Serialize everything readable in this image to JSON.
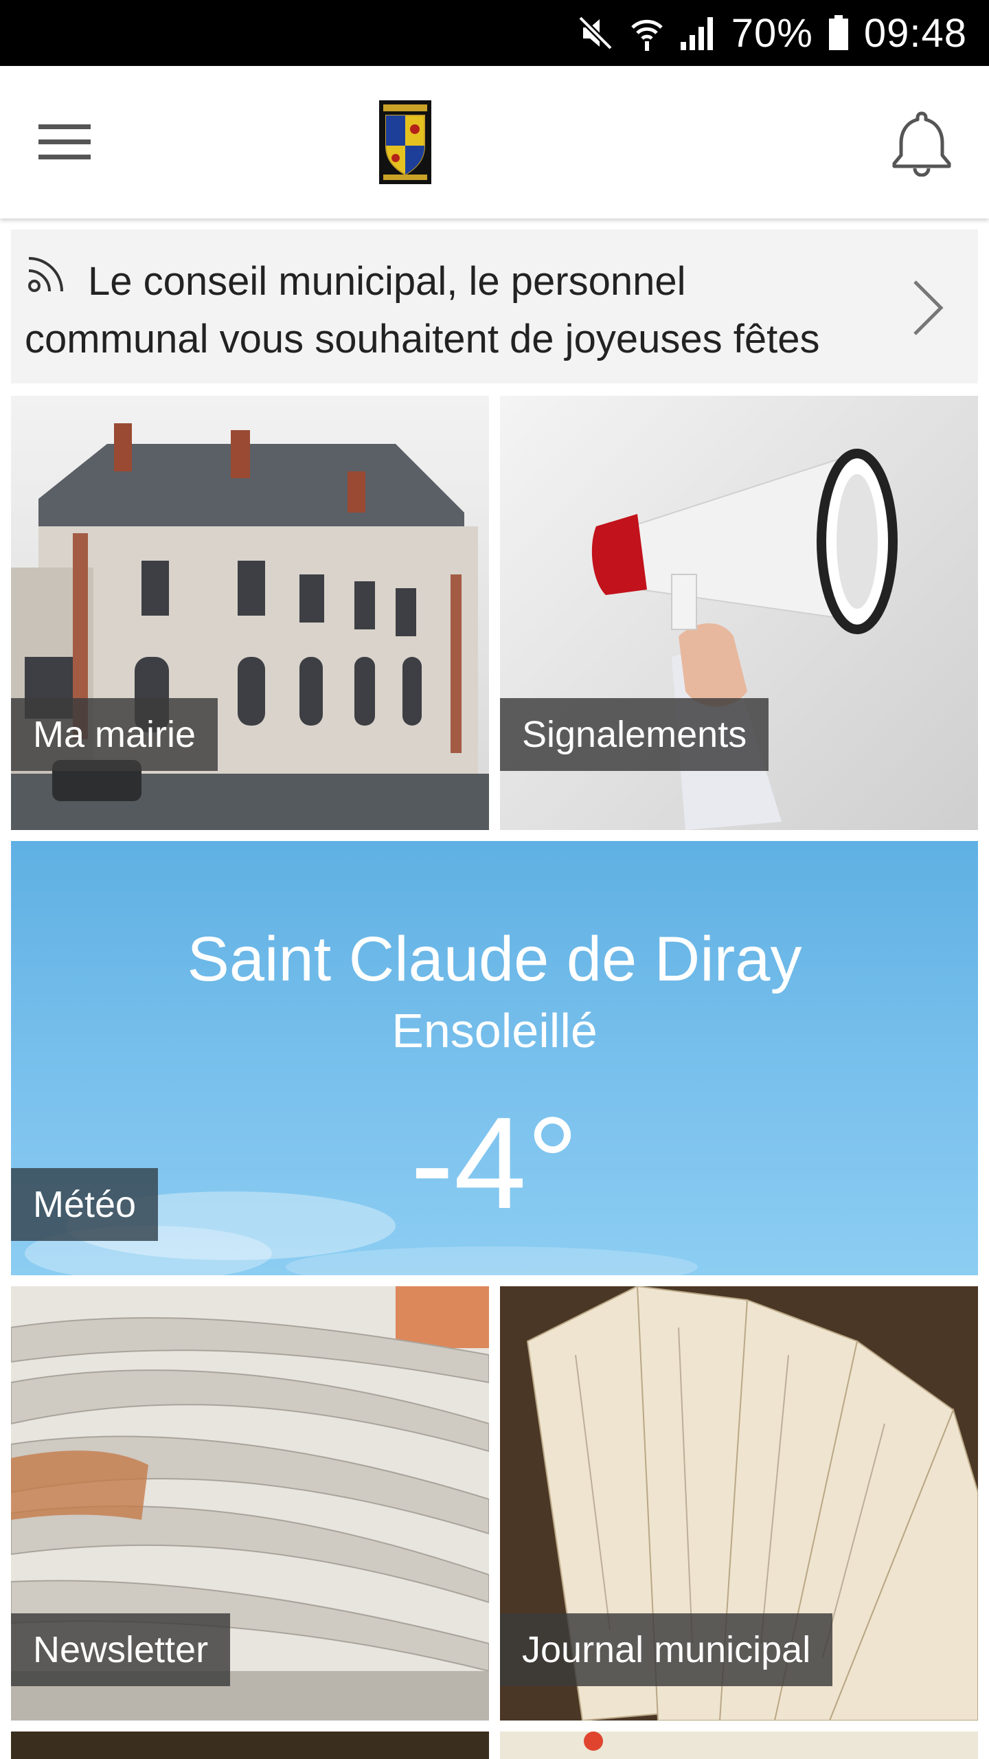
{
  "status_bar": {
    "battery": "70%",
    "time": "09:48"
  },
  "app_bar": {
    "menu_icon": "hamburger-menu-icon",
    "logo": "coat-of-arms-logo",
    "notifications_icon": "bell-icon"
  },
  "ticker": {
    "icon": "rss-icon",
    "text": "Le conseil municipal, le personnel communal vous souhaitent de joyeuses fêtes",
    "chevron_icon": "chevron-right-icon"
  },
  "tiles": {
    "mairie": {
      "label": "Ma mairie"
    },
    "signalements": {
      "label": "Signalements"
    },
    "meteo": {
      "label": "Météo",
      "city": "Saint Claude de Diray",
      "condition": "Ensoleillé",
      "temperature": "-4°"
    },
    "newsletter": {
      "label": "Newsletter"
    },
    "journal": {
      "label": "Journal municipal"
    }
  },
  "colors": {
    "status_bar": "#000000",
    "app_bar": "#ffffff",
    "tile_label_bg": "#3c3c3c",
    "sky": "#7cc2ee"
  }
}
